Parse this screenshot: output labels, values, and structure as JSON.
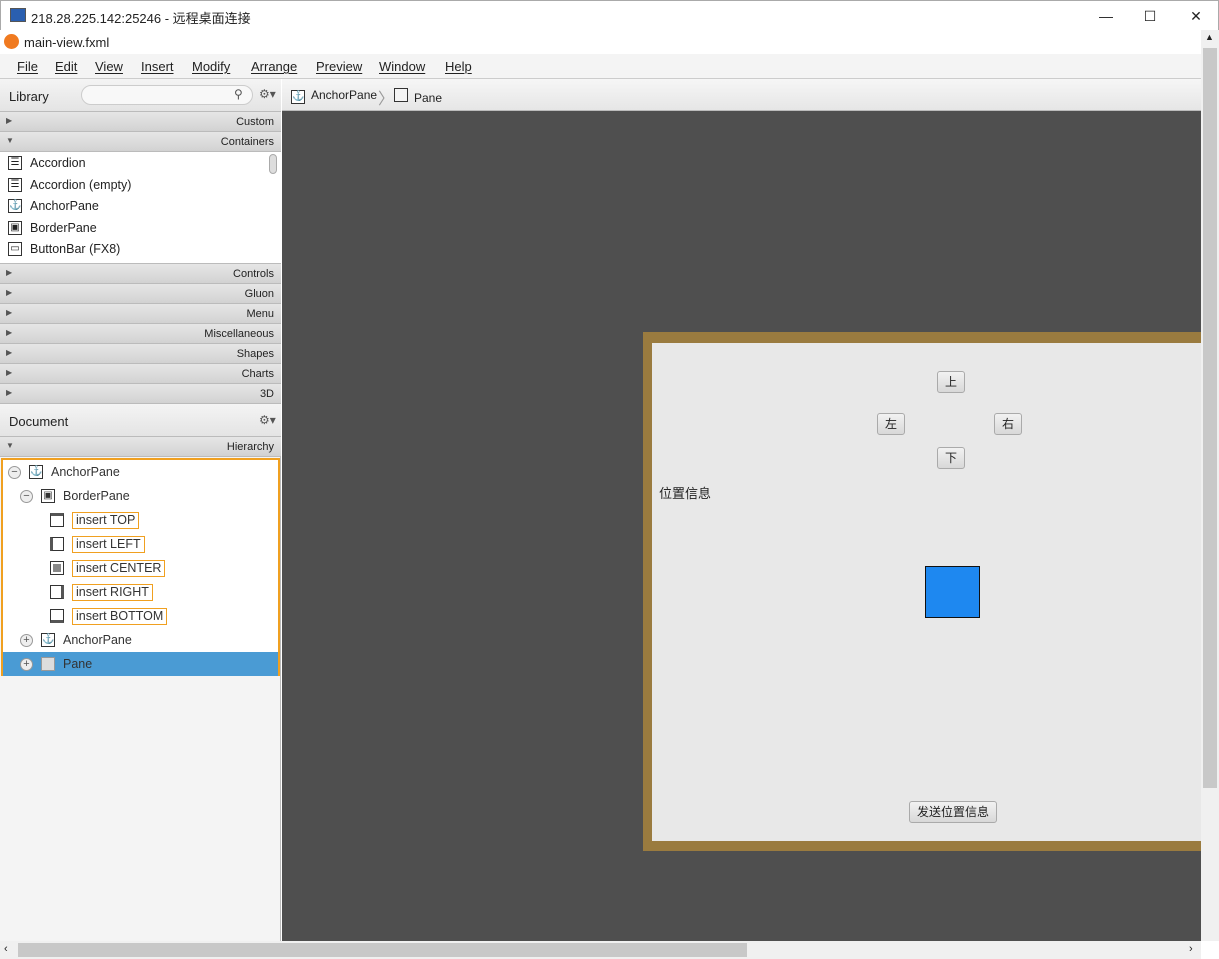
{
  "window": {
    "title": "218.28.225.142:25246 - 远程桌面连接",
    "minimize": "—",
    "maximize": "☐",
    "close": "✕"
  },
  "app": {
    "file_title": "main-view.fxml"
  },
  "menu": [
    "File",
    "Edit",
    "View",
    "Insert",
    "Modify",
    "Arrange",
    "Preview",
    "Window",
    "Help"
  ],
  "library": {
    "title": "Library",
    "search_placeholder": "",
    "sections_top": [
      "Custom",
      "Containers"
    ],
    "items": [
      "Accordion",
      "Accordion  (empty)",
      "AnchorPane",
      "BorderPane",
      "ButtonBar  (FX8)"
    ],
    "sections_bottom": [
      "Controls",
      "Gluon",
      "Menu",
      "Miscellaneous",
      "Shapes",
      "Charts",
      "3D"
    ]
  },
  "breadcrumb": [
    "AnchorPane",
    "Pane"
  ],
  "document": {
    "title": "Document",
    "section": "Hierarchy",
    "tree": [
      {
        "label": "AnchorPane",
        "toggle": "−"
      },
      {
        "label": "BorderPane",
        "toggle": "−"
      },
      {
        "label": "insert TOP"
      },
      {
        "label": "insert LEFT"
      },
      {
        "label": "insert CENTER"
      },
      {
        "label": "insert RIGHT"
      },
      {
        "label": "insert BOTTOM"
      },
      {
        "label": "AnchorPane",
        "toggle": "+"
      },
      {
        "label": "Pane",
        "toggle": "+",
        "selected": true
      }
    ]
  },
  "design": {
    "up": "上",
    "left": "左",
    "right": "右",
    "down": "下",
    "position_label": "位置信息",
    "send_button": "发送位置信息",
    "square_color": "#1e88f0",
    "border_color": "#9a7b3f"
  },
  "colors": {
    "selection": "#4a9bd4",
    "highlight": "#f0a020"
  }
}
